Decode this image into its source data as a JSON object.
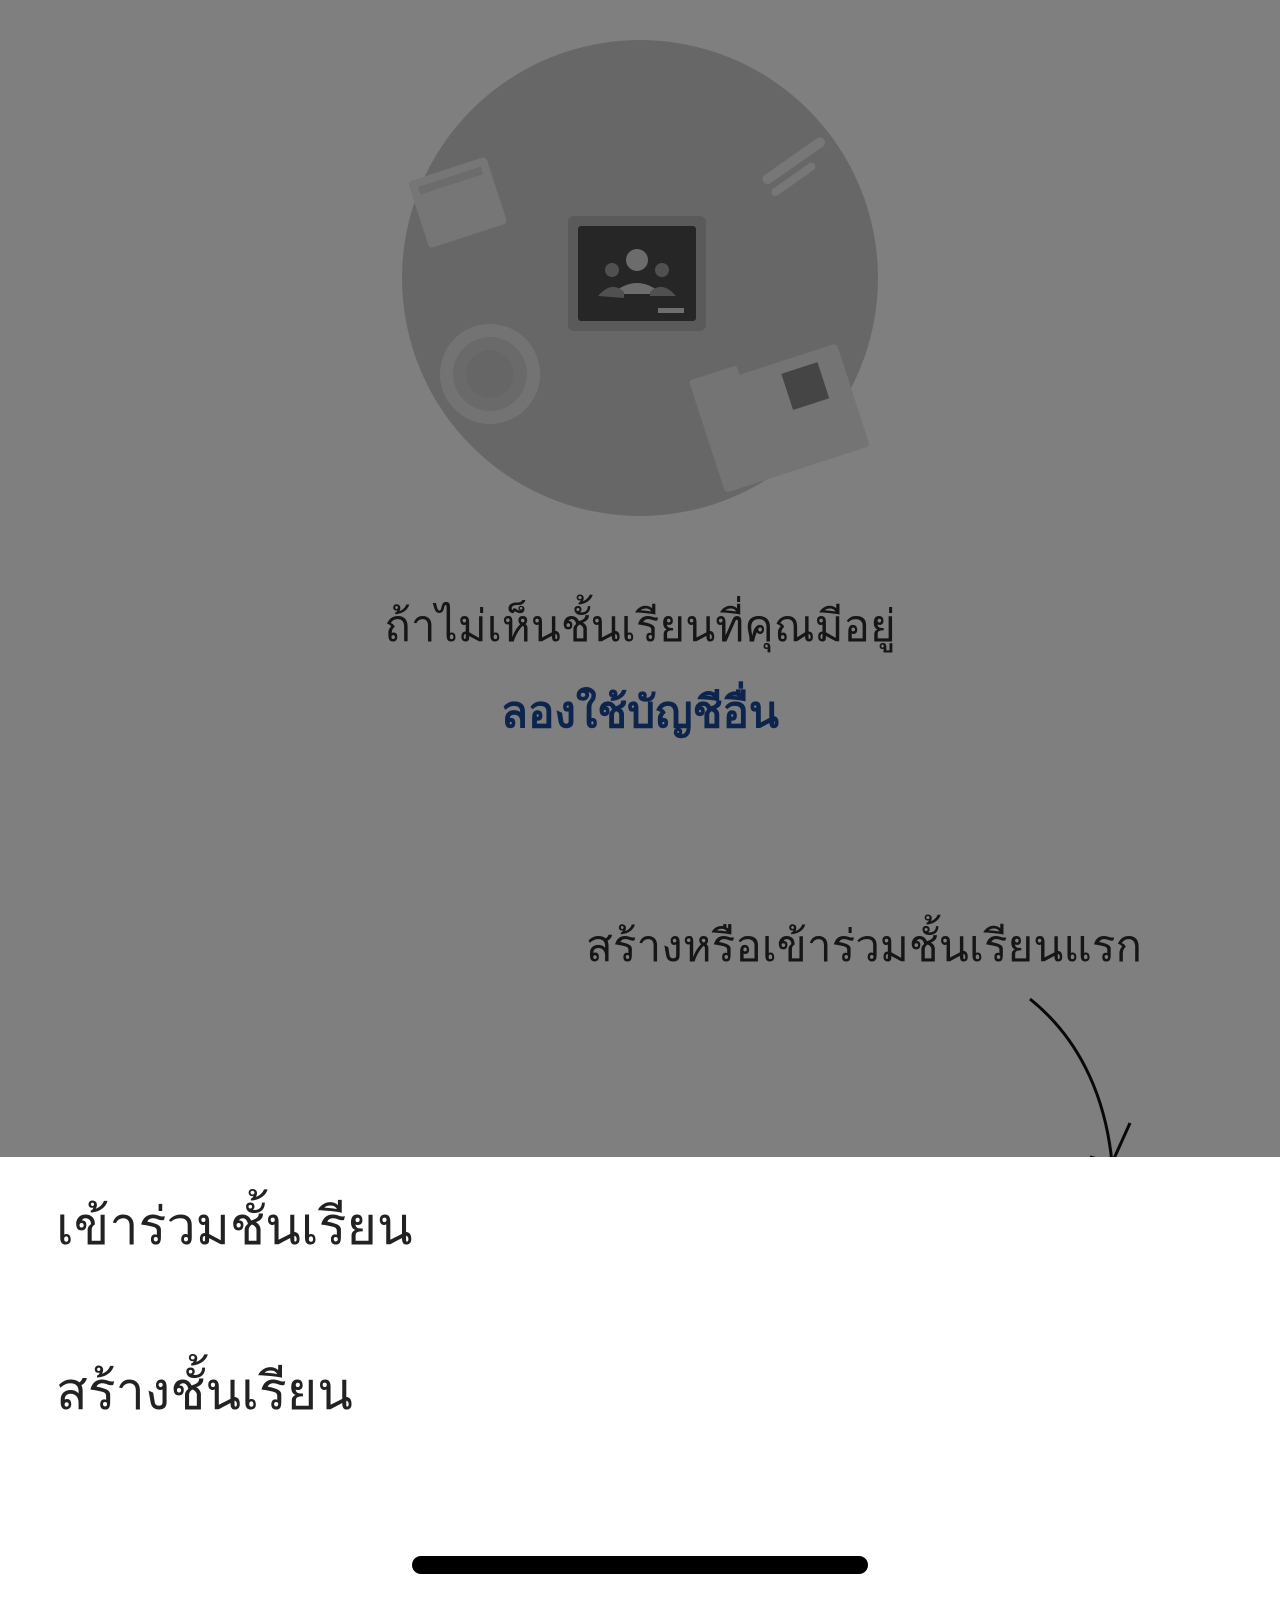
{
  "empty_state": {
    "message": "ถ้าไม่เห็นชั้นเรียนที่คุณมีอยู่",
    "link": "ลองใช้บัญชีอื่น",
    "hint": "สร้างหรือเข้าร่วมชั้นเรียนแรก"
  },
  "sheet": {
    "items": [
      {
        "label": "เข้าร่วมชั้นเรียน"
      },
      {
        "label": "สร้างชั้นเรียน"
      }
    ]
  },
  "colors": {
    "scrim": "rgba(0,0,0,0.5)",
    "link": "#1a4b9a",
    "sheet_background": "#ffffff",
    "home_indicator": "#000000"
  },
  "icons": {
    "illustration": "classroom-illustration-icon",
    "hint_arrow": "curved-arrow-icon"
  }
}
